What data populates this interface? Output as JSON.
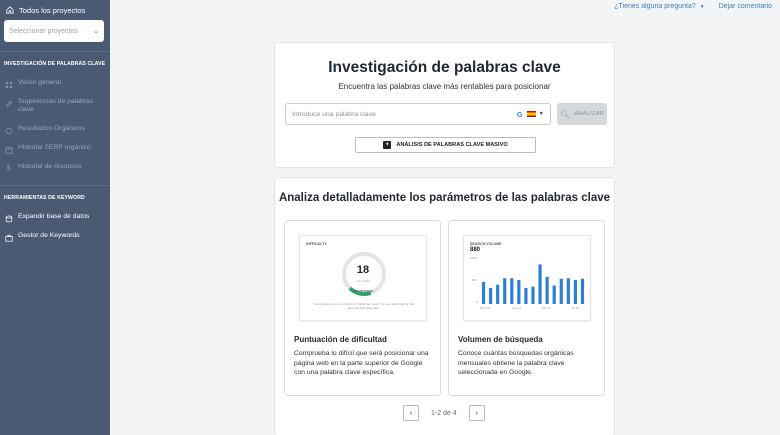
{
  "sidebar": {
    "all_projects": "Todos los proyectos",
    "select_placeholder": "Seleccionar proyectos",
    "section1": "INVESTIGACIÓN DE PALABRAS CLAVE",
    "items1": [
      {
        "label": "Visión general",
        "icon": "grid-icon"
      },
      {
        "label": "Sugerencias de palabras clave",
        "icon": "pencil-icon"
      },
      {
        "label": "Resultados Orgánicos",
        "icon": "circle-icon"
      },
      {
        "label": "Historial SERP orgánico",
        "icon": "calendar-icon"
      },
      {
        "label": "Historial de Anuncios",
        "icon": "dollar-icon"
      }
    ],
    "section2": "HERRAMIENTAS DE KEYWORD",
    "items2": [
      {
        "label": "Expandir base de datos",
        "icon": "database-icon"
      },
      {
        "label": "Gestor de Keywords",
        "icon": "briefcase-icon"
      }
    ]
  },
  "topbar": {
    "question": "¿Tienes alguna pregunta?",
    "feedback": "Dejar comentario"
  },
  "search_card": {
    "title": "Investigación de palabras clave",
    "subtitle": "Encuentra las palabras clave más rentables para posicionar",
    "input_placeholder": "Introduce una palabra clave",
    "engine_icon": "G",
    "analyze_label": "ANALIZAR",
    "bulk_label": "ANÁLISIS DE PALABRAS CLAVE MASIVO"
  },
  "features_card": {
    "title": "Analiza detalladamente los parámetros de las palabras clave",
    "features": [
      {
        "title": "Puntuación de dificultad",
        "description": "Comprueba lo difícil que será posicionar una página web en la parte superior de Google con una palabra clave específica.",
        "thumb_label": "DIFFICULTY",
        "thumb_value": "18",
        "thumb_sub": "out of 100",
        "thumb_level": "EFFORTLESS",
        "thumb_note": "Your chances to get to the top of SERP are good. You can rank high for this keyword with little effort.",
        "gauge_fraction": 0.18
      },
      {
        "title": "Volumen de búsqueda",
        "description": "Conoce cuántas búsquedas orgánicas mensuales obtiene la palabra clave seleccionada en Google.",
        "thumb_label": "SEARCH VOLUME",
        "thumb_value": "880",
        "y_ticks": [
          "1000",
          "500",
          "0"
        ],
        "x_ticks": [
          "Dec 20",
          "Jan 21",
          "Apr 21",
          "Jul 21"
        ]
      }
    ],
    "pagination": "1-2 de 4"
  },
  "chart_data": {
    "type": "bar",
    "title": "SEARCH VOLUME",
    "ylim": [
      0,
      1000
    ],
    "values": [
      480,
      350,
      420,
      560,
      560,
      520,
      350,
      380,
      860,
      590,
      400,
      550,
      560,
      520,
      550
    ]
  },
  "colors": {
    "sidebar_bg": "#4a5a73",
    "accent_link": "#3b82b8",
    "bar": "#2d7fd0",
    "gauge_green": "#2fa36b"
  }
}
